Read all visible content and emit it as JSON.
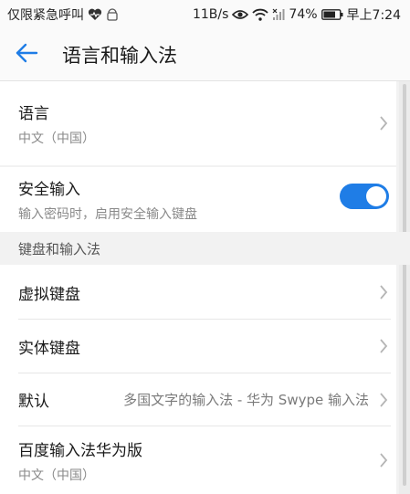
{
  "status_bar": {
    "carrier": "仅限紧急呼叫",
    "net_speed": "11B/s",
    "battery": "74%",
    "time": "早上7:24"
  },
  "app_bar": {
    "title": "语言和输入法",
    "back_icon": "arrow-left-icon",
    "accent_color": "#1f7de6"
  },
  "language": {
    "label": "语言",
    "value": "中文（中国）"
  },
  "secure_input": {
    "label": "安全输入",
    "desc": "输入密码时，启用安全输入键盘",
    "enabled": true
  },
  "keyboards_section": {
    "header": "键盘和输入法",
    "items": [
      {
        "label": "虚拟键盘"
      },
      {
        "label": "实体键盘"
      },
      {
        "label": "默认",
        "value": "多国文字的输入法 - 华为 Swype 输入法"
      },
      {
        "label": "百度输入法华为版",
        "sub": "中文（中国）"
      }
    ]
  }
}
